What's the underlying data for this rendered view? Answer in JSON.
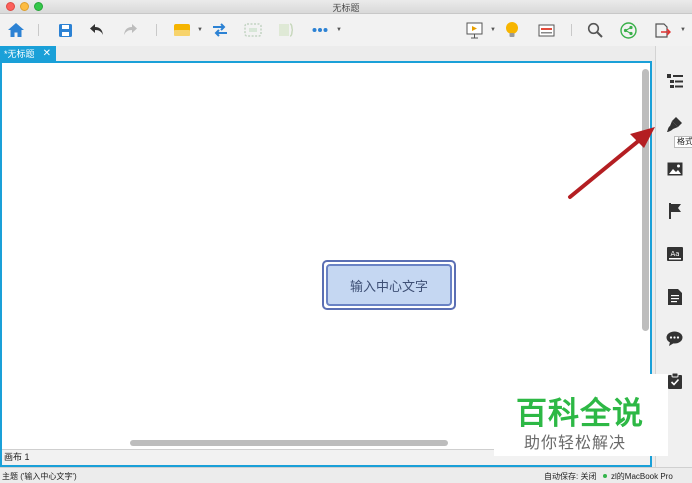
{
  "window": {
    "title": "无标题"
  },
  "toolbar": {
    "icons": [
      "home-icon",
      "save-icon",
      "undo-icon",
      "redo-icon",
      "topic-icon",
      "relationship-icon",
      "boundary-icon",
      "summary-icon",
      "more-icon",
      "presentation-icon",
      "idea-icon",
      "outline-view-icon",
      "search-icon",
      "share-icon",
      "export-icon"
    ]
  },
  "tabs": [
    {
      "label": "*无标题",
      "close": "✕"
    }
  ],
  "canvas": {
    "central_topic": "输入中心文字"
  },
  "sheets": [
    {
      "label": "画布 1"
    }
  ],
  "right_panel": {
    "icons": [
      "outline-icon",
      "format-brush-icon",
      "image-icon",
      "marker-flag-icon",
      "style-aa-icon",
      "notes-icon",
      "comment-icon",
      "task-icon"
    ],
    "tooltip": "格式"
  },
  "status": {
    "selection": "主题 ('输入中心文字')",
    "autosave": "自动保存: 关闭",
    "machine": "zl的MacBook Pro"
  },
  "watermark": {
    "title": "百科全说",
    "subtitle": "助你轻松解决"
  },
  "colors": {
    "accent": "#1aa0d8",
    "arrow": "#b41e22",
    "watermark_green": "#2db845"
  }
}
